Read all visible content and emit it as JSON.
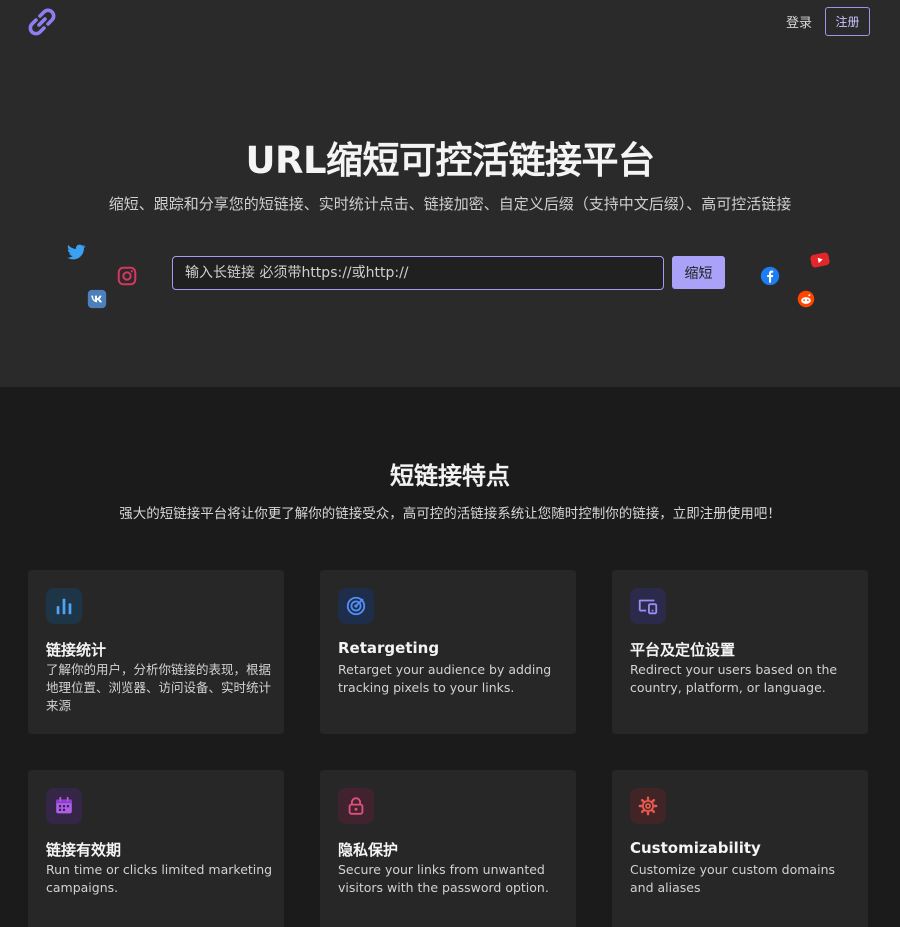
{
  "nav": {
    "login": "登录",
    "signup": "注册"
  },
  "hero": {
    "title": "URL缩短可控活链接平台",
    "subtitle": "缩短、跟踪和分享您的短链接、实时统计点击、链接加密、自定义后缀（支持中文后缀）、高可控活链接",
    "input_placeholder": "输入长链接 必须带https://或http://",
    "button": "缩短"
  },
  "colors": {
    "accent": "#a9a2f8",
    "hero_bg": "#2a2a2b",
    "page_bg": "#1b1b1c",
    "card_bg": "#272728"
  },
  "social_icons": [
    "twitter-icon",
    "instagram-icon",
    "vk-icon",
    "facebook-icon",
    "youtube-icon",
    "reddit-icon"
  ],
  "features": {
    "title": "短链接特点",
    "subtitle": "强大的短链接平台将让你更了解你的链接受众，高可控的活链接系统让您随时控制你的链接，立即注册使用吧！",
    "cards": [
      {
        "icon": "bar-chart-icon",
        "color": "#4ea3f2",
        "title": "链接统计",
        "desc": "了解你的用户，分析你链接的表现，根据地理位置、浏览器、访问设备、实时统计来源"
      },
      {
        "icon": "target-icon",
        "color": "#4f8ff7",
        "title": "Retargeting",
        "desc": "Retarget your audience by adding tracking pixels to your links."
      },
      {
        "icon": "devices-icon",
        "color": "#9a8df5",
        "title": "平台及定位设置",
        "desc": "Redirect your users based on the country, platform, or language."
      },
      {
        "icon": "calendar-icon",
        "color": "#b05ee8",
        "title": "链接有效期",
        "desc": "Run time or clicks limited marketing campaigns."
      },
      {
        "icon": "lock-icon",
        "color": "#e2507a",
        "title": "隐私保护",
        "desc": "Secure your links from unwanted visitors with the password option."
      },
      {
        "icon": "gear-icon",
        "color": "#e7594f",
        "title": "Customizability",
        "desc": "Customize your custom domains and aliases"
      }
    ]
  }
}
